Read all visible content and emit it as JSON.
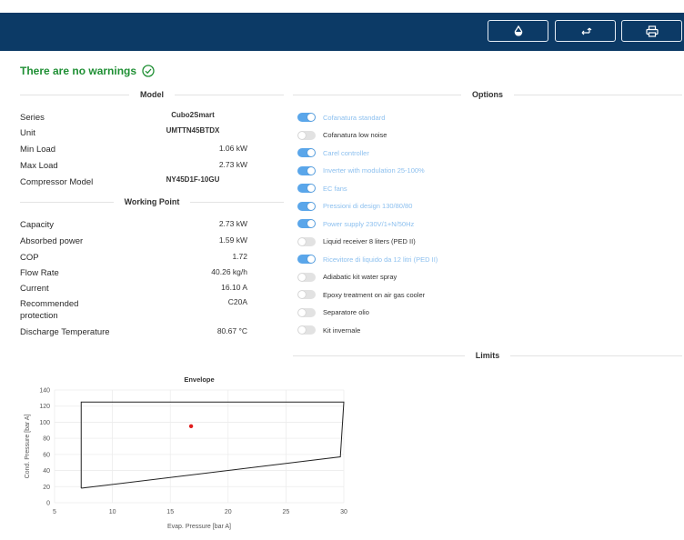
{
  "toolbar": {
    "buttons": [
      {
        "name": "water-drop-button",
        "icon": "water-drop-icon"
      },
      {
        "name": "swap-arrows-button",
        "icon": "swap-arrows-icon"
      },
      {
        "name": "print-button",
        "icon": "printer-icon"
      }
    ],
    "bar_color": "#0c3a66"
  },
  "status": {
    "text": "There are no warnings",
    "icon": "check-circle-icon",
    "color": "#1f8f34"
  },
  "model": {
    "title": "Model",
    "rows": [
      {
        "label": "Series",
        "value": "Cubo2Smart"
      },
      {
        "label": "Unit",
        "value": "UMTTN45BTDX"
      },
      {
        "label": "Min Load",
        "value": "1.06 kW"
      },
      {
        "label": "Max Load",
        "value": "2.73 kW"
      },
      {
        "label": "Compressor Model",
        "value": "NY45D1F-10GU"
      }
    ]
  },
  "working_point": {
    "title": "Working Point",
    "rows": [
      {
        "label": "Capacity",
        "value": "2.73 kW"
      },
      {
        "label": "Absorbed power",
        "value": "1.59 kW"
      },
      {
        "label": "COP",
        "value": "1.72"
      },
      {
        "label": "Flow Rate",
        "value": "40.26 kg/h"
      },
      {
        "label": "Current",
        "value": "16.10 A"
      },
      {
        "label": "Recommended protection",
        "value": "C20A"
      },
      {
        "label": "Discharge Temperature",
        "value": "80.67 °C"
      }
    ]
  },
  "options": {
    "title": "Options",
    "items": [
      {
        "label": "Cofanatura standard",
        "on": true
      },
      {
        "label": "Cofanatura low noise",
        "on": false
      },
      {
        "label": "Carel controller",
        "on": true
      },
      {
        "label": "Inverter with modulation 25-100%",
        "on": true
      },
      {
        "label": "EC fans",
        "on": true
      },
      {
        "label": "Pressioni di design 130/80/80",
        "on": true
      },
      {
        "label": "Power supply 230V/1+N/50Hz",
        "on": true
      },
      {
        "label": "Liquid receiver 8 liters (PED II)",
        "on": false
      },
      {
        "label": "Ricevitore di liquido da 12 litri (PED II)",
        "on": true
      },
      {
        "label": "Adiabatic kit water spray",
        "on": false
      },
      {
        "label": "Epoxy treatment on air gas cooler",
        "on": false
      },
      {
        "label": "Separatore olio",
        "on": false
      },
      {
        "label": "Kit invernale",
        "on": false
      }
    ]
  },
  "limits": {
    "title": "Limits"
  },
  "chart_data": {
    "type": "line",
    "title": "Envelope",
    "xlabel": "Evap. Pressure [bar A]",
    "ylabel": "Cond. Pressure [bar A]",
    "xlim": [
      5,
      30
    ],
    "ylim": [
      0,
      140
    ],
    "xticks": [
      5,
      10,
      15,
      20,
      25,
      30
    ],
    "yticks": [
      0,
      20,
      40,
      60,
      80,
      100,
      120,
      140
    ],
    "grid": true,
    "series": [
      {
        "x": [
          7.3,
          7.3,
          30.0,
          29.7,
          7.3
        ],
        "y": [
          18,
          125,
          125,
          57,
          18
        ],
        "color": "#222222"
      },
      {
        "type": "scatter",
        "x": [
          16.8
        ],
        "y": [
          95
        ],
        "color": "#e11d1d"
      }
    ]
  }
}
